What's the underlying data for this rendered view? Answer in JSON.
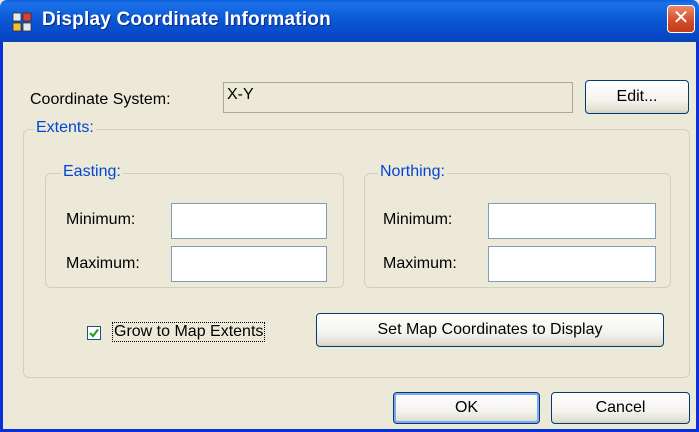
{
  "window": {
    "title": "Display Coordinate Information",
    "close_glyph": "✕"
  },
  "coordinate_system": {
    "label": "Coordinate System:",
    "value": "X-Y",
    "edit_button": "Edit..."
  },
  "extents": {
    "legend": "Extents:",
    "easting": {
      "legend": "Easting:",
      "minimum_label": "Minimum:",
      "maximum_label": "Maximum:",
      "minimum_value": "",
      "maximum_value": ""
    },
    "northing": {
      "legend": "Northing:",
      "minimum_label": "Minimum:",
      "maximum_label": "Maximum:",
      "minimum_value": "",
      "maximum_value": ""
    },
    "grow_checkbox": {
      "label": "Grow to Map Extents",
      "checked": true,
      "glyph": "✓"
    },
    "set_map_button": "Set Map Coordinates to Display"
  },
  "footer": {
    "ok_button": "OK",
    "cancel_button": "Cancel"
  },
  "colors": {
    "titlebar": "#0b58d6",
    "dialog_bg": "#ece9d8",
    "group_legend": "#0046d5",
    "close_button": "#d3502b"
  }
}
